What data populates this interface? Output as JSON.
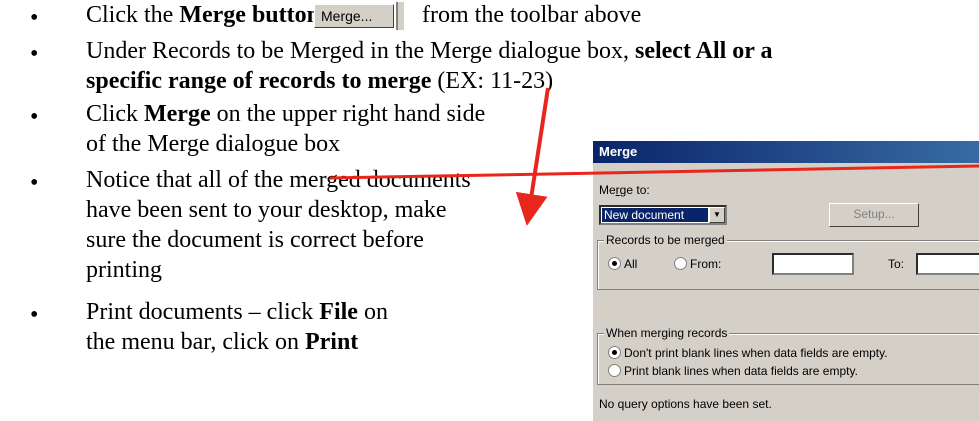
{
  "steps": [
    {
      "pre": "Click the ",
      "bold": "Merge button",
      "post": "from the toolbar above"
    },
    {
      "pre": "Under Records to be Merged in the Merge dialogue box, ",
      "bold": "select All or a",
      "line2_bold": "specific range of records to merge",
      "line2_post": " (EX: 11-23)"
    },
    {
      "pre": "Click ",
      "bold": "Merge",
      "post": " on the upper right hand side",
      "line2": "of the Merge dialogue box"
    },
    {
      "text1": "Notice that all of the merged documents",
      "text2": "have been sent to your desktop, make",
      "text3": "sure the document is correct before",
      "text4": "printing"
    },
    {
      "pre": "Print documents – click ",
      "bold": "File",
      "post": " on",
      "line2_pre": "the menu bar, click on ",
      "line2_bold": "Print"
    }
  ],
  "toolbar_button": {
    "label": "Merge..."
  },
  "dialog": {
    "title": "Merge",
    "merge_to_label": "Merge to:",
    "merge_to_value": "New document",
    "setup_button": "Setup...",
    "records_group": "Records to be merged",
    "all_label": "All",
    "from_label": "From:",
    "to_label": "To:",
    "when_group": "When merging records",
    "opt_dont_print": "Don't print blank lines when data fields are empty.",
    "opt_print": "Print blank lines when data fields are empty.",
    "status": "No query options have been set."
  },
  "colors": {
    "arrow": "#e8261c",
    "title_bar": "#0a246a"
  }
}
